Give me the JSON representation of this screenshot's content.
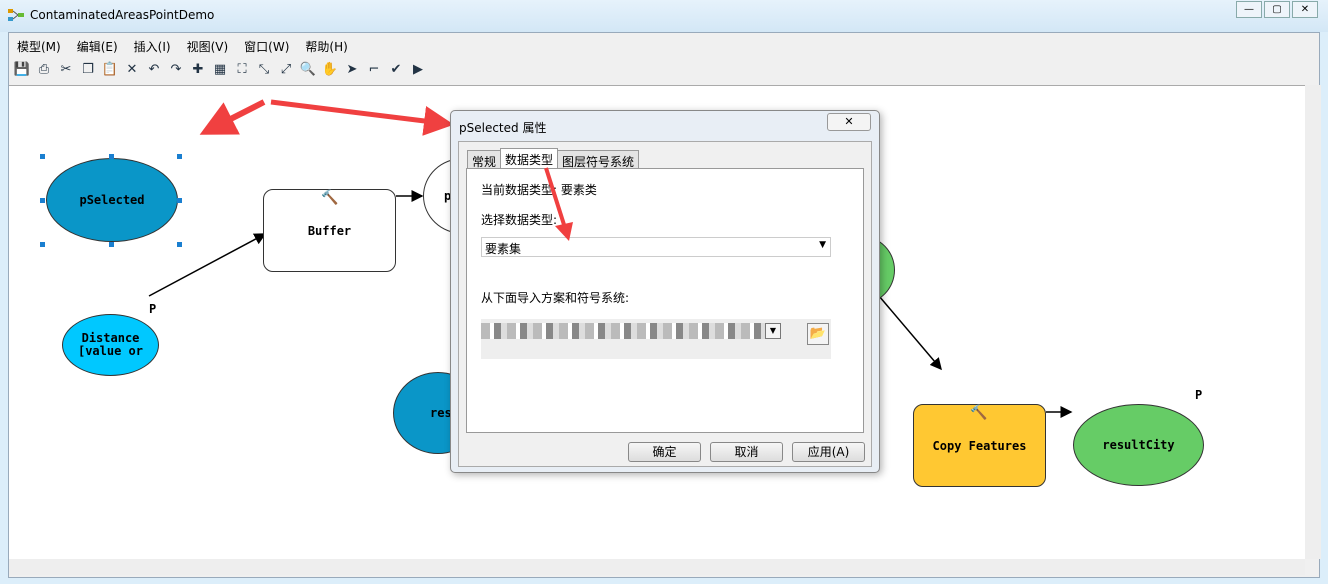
{
  "window": {
    "title": "ContaminatedAreasPointDemo",
    "min": "—",
    "max": "▢",
    "close": "✕"
  },
  "menu": [
    "模型(M)",
    "编辑(E)",
    "插入(I)",
    "视图(V)",
    "窗口(W)",
    "帮助(H)"
  ],
  "toolbar": [
    {
      "icon": "save-icon",
      "glyph": "💾"
    },
    {
      "icon": "print-icon",
      "glyph": "⎙"
    },
    {
      "icon": "cut-icon",
      "glyph": "✂"
    },
    {
      "icon": "copy-icon",
      "glyph": "❐"
    },
    {
      "icon": "paste-icon",
      "glyph": "📋"
    },
    {
      "icon": "delete-icon",
      "glyph": "✕"
    },
    {
      "icon": "undo-icon",
      "glyph": "↶"
    },
    {
      "icon": "redo-icon",
      "glyph": "↷"
    },
    {
      "icon": "add-data-icon",
      "glyph": "✚"
    },
    {
      "icon": "auto-layout-icon",
      "glyph": "▦"
    },
    {
      "icon": "full-extent-icon",
      "glyph": "⛶"
    },
    {
      "icon": "zoom-in-fixed-icon",
      "glyph": "⤡"
    },
    {
      "icon": "zoom-out-fixed-icon",
      "glyph": "⤢"
    },
    {
      "icon": "zoom-icon",
      "glyph": "🔍"
    },
    {
      "icon": "pan-icon",
      "glyph": "✋"
    },
    {
      "icon": "select-icon",
      "glyph": "➤"
    },
    {
      "icon": "connect-icon",
      "glyph": "⌐"
    },
    {
      "icon": "validate-icon",
      "glyph": "✔"
    },
    {
      "icon": "run-icon",
      "glyph": "▶"
    }
  ],
  "model": {
    "pSelected": "pSelected",
    "buffer": "Buffer",
    "distance": "Distance [value or",
    "copy": "Copy Features",
    "resultCity": "resultCity",
    "res": "res",
    "p_partial": "p",
    "p": "P",
    "colors": {
      "input": "#0a96c8",
      "value": "#00c8ff",
      "tool": "#ffc832",
      "output": "#66cc66",
      "arrow": "#f04040"
    }
  },
  "dialog": {
    "title": "pSelected 属性",
    "close": "✕",
    "tabs": [
      "常规",
      "数据类型",
      "图层符号系统"
    ],
    "current_type": "当前数据类型: 要素类",
    "select_label": "选择数据类型:",
    "select_value": "要素集",
    "import_label": "从下面导入方案和符号系统:",
    "buttons": {
      "ok": "确定",
      "cancel": "取消",
      "apply": "应用(A)"
    }
  }
}
